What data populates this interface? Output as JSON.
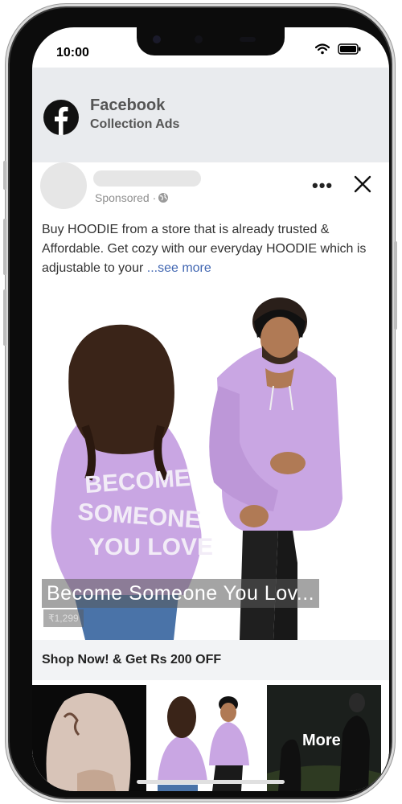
{
  "status": {
    "time": "10:00"
  },
  "header": {
    "title": "Facebook",
    "subtitle": "Collection Ads"
  },
  "post": {
    "sponsored_label": "Sponsored ·",
    "description": "Buy HOODIE from a store that is already trusted & Affordable. Get cozy with our everyday HOODIE which is adjustable to your ",
    "see_more": "...see more"
  },
  "hero": {
    "caption": "Become Someone You Lov...",
    "price": "₹1,299"
  },
  "offer": {
    "label": "Shop Now! & Get Rs 200 OFF"
  },
  "thumbs": {
    "more_label": "More"
  },
  "colors": {
    "accent": "#4267b2",
    "hoodie": "#c9a6e3",
    "header_bg": "#e9ebee"
  }
}
